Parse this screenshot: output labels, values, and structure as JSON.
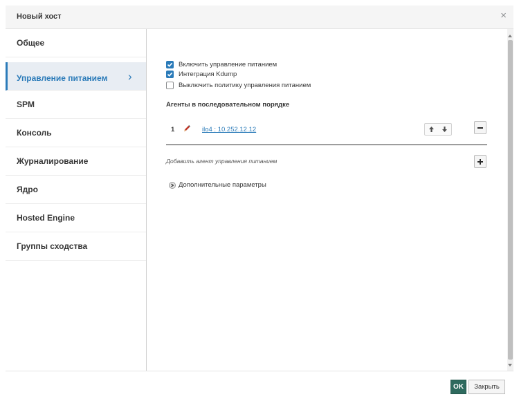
{
  "dialog": {
    "title": "Новый хост",
    "close_glyph": "×"
  },
  "sidebar": {
    "items": [
      {
        "label": "Общее",
        "active": false
      },
      {
        "label": "Управление питанием",
        "active": true
      },
      {
        "label": "SPM",
        "active": false
      },
      {
        "label": "Консоль",
        "active": false
      },
      {
        "label": "Журналирование",
        "active": false
      },
      {
        "label": "Ядро",
        "active": false
      },
      {
        "label": "Hosted Engine",
        "active": false
      },
      {
        "label": "Группы сходства",
        "active": false
      }
    ],
    "active_chevron": "›"
  },
  "power": {
    "checkboxes": [
      {
        "label": "Включить управление питанием",
        "checked": true
      },
      {
        "label": "Интеграция Kdump",
        "checked": true
      },
      {
        "label": "Выключить политику управления питанием",
        "checked": false
      }
    ],
    "agents_title": "Агенты в последовательном порядке",
    "agents": [
      {
        "order": "1",
        "name": "ilo4 : 10.252.12.12"
      }
    ],
    "add_agent_label": "Добавить агент управления питанием",
    "advanced_label": "Дополнительные параметры"
  },
  "footer": {
    "ok_label": "OK",
    "close_label": "Закрыть"
  },
  "icons": {
    "edit": "pencil-icon",
    "move_up": "arrow-up-icon",
    "move_down": "arrow-down-icon",
    "remove": "minus-icon",
    "add": "plus-icon",
    "expand": "chevron-right-circle-icon"
  },
  "colors": {
    "accent": "#2b7bb9",
    "ok_button": "#2e6a5e",
    "header_bg": "#f5f5f5",
    "active_nav_bg": "#e8edf3"
  }
}
